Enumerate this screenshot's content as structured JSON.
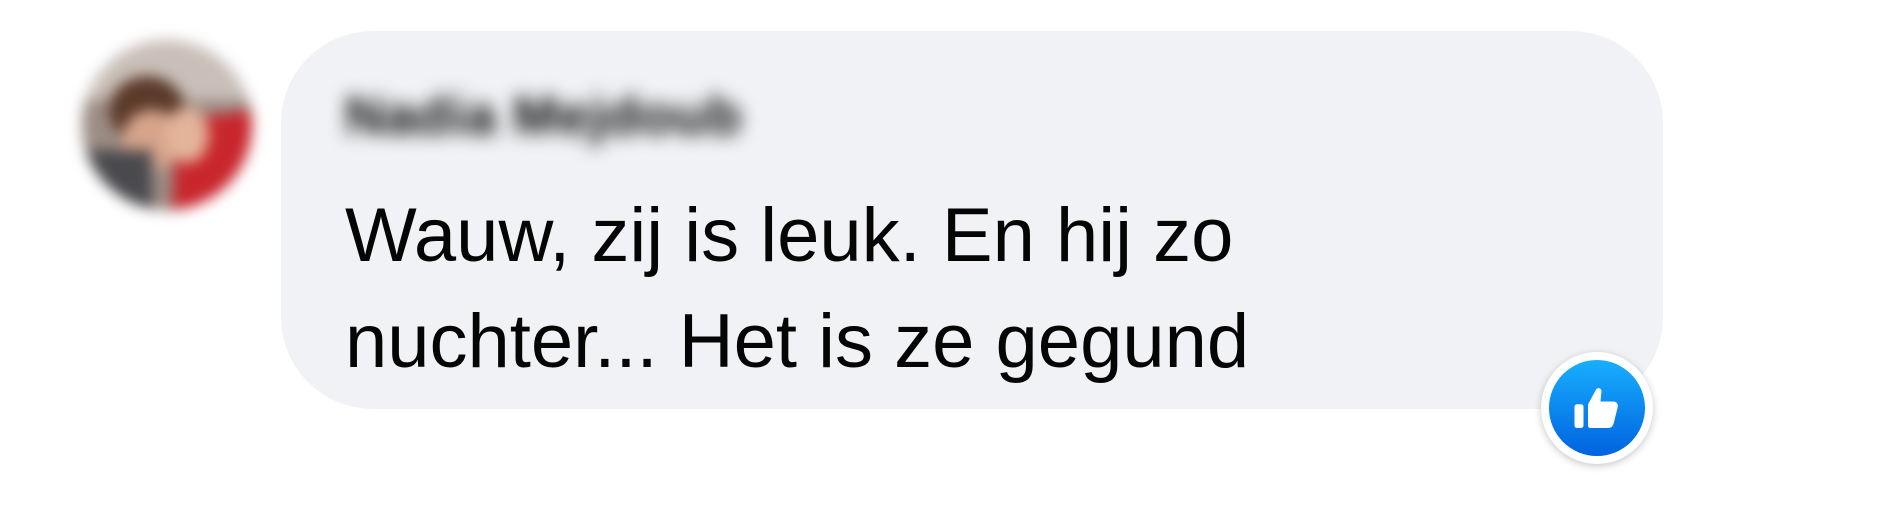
{
  "comment": {
    "author_name": "Nadia Mejdoub",
    "text": "Wauw, zij is leuk. En hij zo nuchter... Het is ze gegund",
    "reaction": {
      "type": "like",
      "icon": "thumbs-up-icon",
      "color": "#0866ff"
    },
    "colors": {
      "bubble": "#f0f2f5",
      "text": "#050505"
    }
  }
}
